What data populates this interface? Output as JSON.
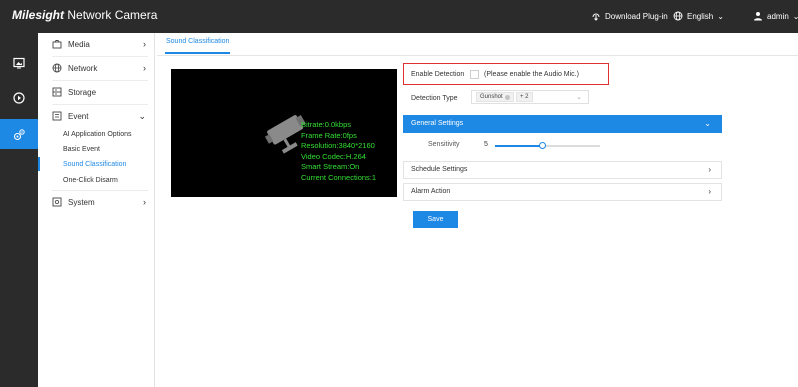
{
  "topbar": {
    "brand_logo": "Milesight",
    "brand_product": "Network Camera",
    "download_plugin": "Download Plug-in",
    "language": "English",
    "user": "admin"
  },
  "iconbar": {
    "items": [
      {
        "icon": "live-view-icon"
      },
      {
        "icon": "playback-icon"
      },
      {
        "icon": "settings-gear-icon",
        "active": true
      }
    ]
  },
  "sidebar": {
    "items": [
      {
        "label": "Media",
        "icon": "media-icon",
        "arrow": "›"
      },
      {
        "label": "Network",
        "icon": "globe-icon",
        "arrow": "›"
      },
      {
        "label": "Storage",
        "icon": "storage-icon"
      },
      {
        "label": "Event",
        "icon": "event-icon",
        "arrow": "⌄"
      },
      {
        "label": "System",
        "icon": "system-icon",
        "arrow": "›"
      }
    ],
    "event_sub": [
      "AI Application Options",
      "Basic Event",
      "Sound Classification",
      "One-Click Disarm"
    ],
    "active_sub": "Sound Classification"
  },
  "main": {
    "tab": "Sound Classification",
    "video_info": [
      "Bitrate:0.0kbps",
      "Frame Rate:0fps",
      "Resolution:3840*2160",
      "Video Codec:H.264",
      "Smart Stream:On",
      "Current Connections:1"
    ],
    "enable_detection_label": "Enable Detection",
    "enable_detection_checked": false,
    "enable_detection_note": "(Please enable the Audio Mic.)",
    "detection_type_label": "Detection Type",
    "detection_type_chip": "Gunshot",
    "detection_type_more": "+ 2",
    "general_settings": "General Settings",
    "sensitivity_label": "Sensitivity",
    "sensitivity_value": "5",
    "sensitivity_fraction": 0.45,
    "schedule_settings": "Schedule Settings",
    "alarm_action": "Alarm Action",
    "save_label": "Save",
    "accent_color": "#1e88e5",
    "highlight_color": "#e03030"
  }
}
